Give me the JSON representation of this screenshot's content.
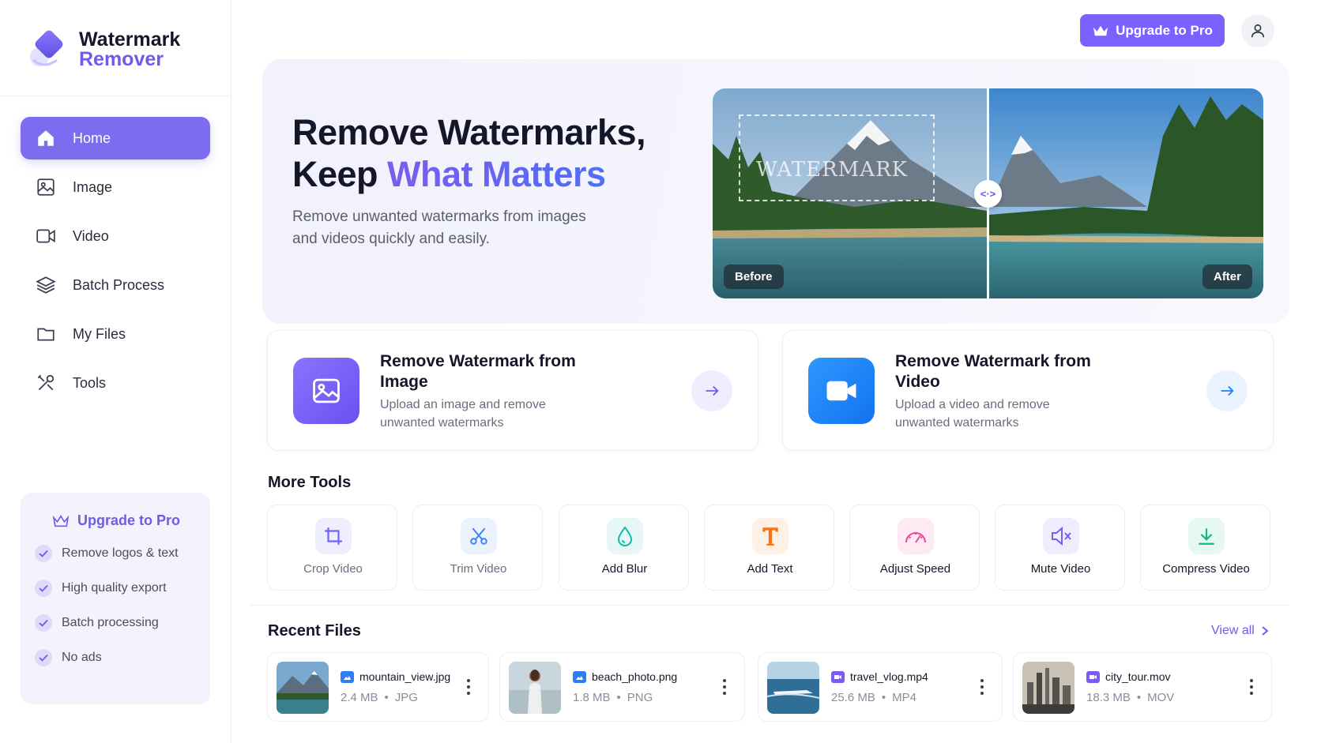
{
  "app": {
    "name_line1": "Watermark",
    "name_line2": "Remover",
    "brand_color": "#7b6cf0"
  },
  "sidebar": {
    "items": [
      {
        "label": "Home",
        "icon": "home-icon",
        "active": true
      },
      {
        "label": "Image",
        "icon": "image-icon",
        "active": false
      },
      {
        "label": "Video",
        "icon": "video-icon",
        "active": false
      },
      {
        "label": "Batch Process",
        "icon": "layers-icon",
        "active": false
      },
      {
        "label": "My Files",
        "icon": "folder-icon",
        "active": false
      },
      {
        "label": "Tools",
        "icon": "tools-icon",
        "active": false
      }
    ],
    "upgrade": {
      "title": "Upgrade to Pro",
      "features": [
        "Remove logos & text",
        "High quality export",
        "Batch processing",
        "No ads"
      ]
    }
  },
  "header": {
    "upgrade_label": "Upgrade to Pro"
  },
  "hero": {
    "title_line1": "Remove Watermarks,",
    "title_line2_plain": "Keep ",
    "title_line2_accent": "What Matters",
    "subtitle": "Remove unwanted watermarks from images and videos quickly and easily.",
    "watermark_text": "WATERMARK",
    "handle_label": "<·>",
    "before_label": "Before",
    "after_label": "After"
  },
  "actions": [
    {
      "title": "Remove Watermark from Image",
      "desc": "Upload an image and remove unwanted watermarks",
      "color": "#7b61ff"
    },
    {
      "title": "Remove Watermark from Video",
      "desc": "Upload a video and remove unwanted watermarks",
      "color": "#1e90ff"
    }
  ],
  "more_tools": {
    "title": "More Tools",
    "items": [
      {
        "label": "Crop Video",
        "icon": "crop-icon",
        "color": "#6c63ff"
      },
      {
        "label": "Trim Video",
        "icon": "scissors-icon",
        "color": "#3b82f6"
      },
      {
        "label": "Add Blur",
        "icon": "drop-icon",
        "color": "#14b8a6"
      },
      {
        "label": "Add Text",
        "icon": "text-icon",
        "color": "#f97316"
      },
      {
        "label": "Adjust Speed",
        "icon": "speedometer-icon",
        "color": "#ec4899"
      },
      {
        "label": "Mute Video",
        "icon": "mute-icon",
        "color": "#7c5cf0"
      },
      {
        "label": "Compress Video",
        "icon": "download-icon",
        "color": "#10b981"
      }
    ]
  },
  "recent": {
    "title": "Recent Files",
    "view_all": "View all",
    "files": [
      {
        "name": "mountain_view.jpg",
        "size": "2.4 MB",
        "type": "JPG",
        "kind": "image"
      },
      {
        "name": "beach_photo.png",
        "size": "1.8 MB",
        "type": "PNG",
        "kind": "image"
      },
      {
        "name": "travel_vlog.mp4",
        "size": "25.6 MB",
        "type": "MP4",
        "kind": "video"
      },
      {
        "name": "city_tour.mov",
        "size": "18.3 MB",
        "type": "MOV",
        "kind": "video"
      }
    ]
  }
}
